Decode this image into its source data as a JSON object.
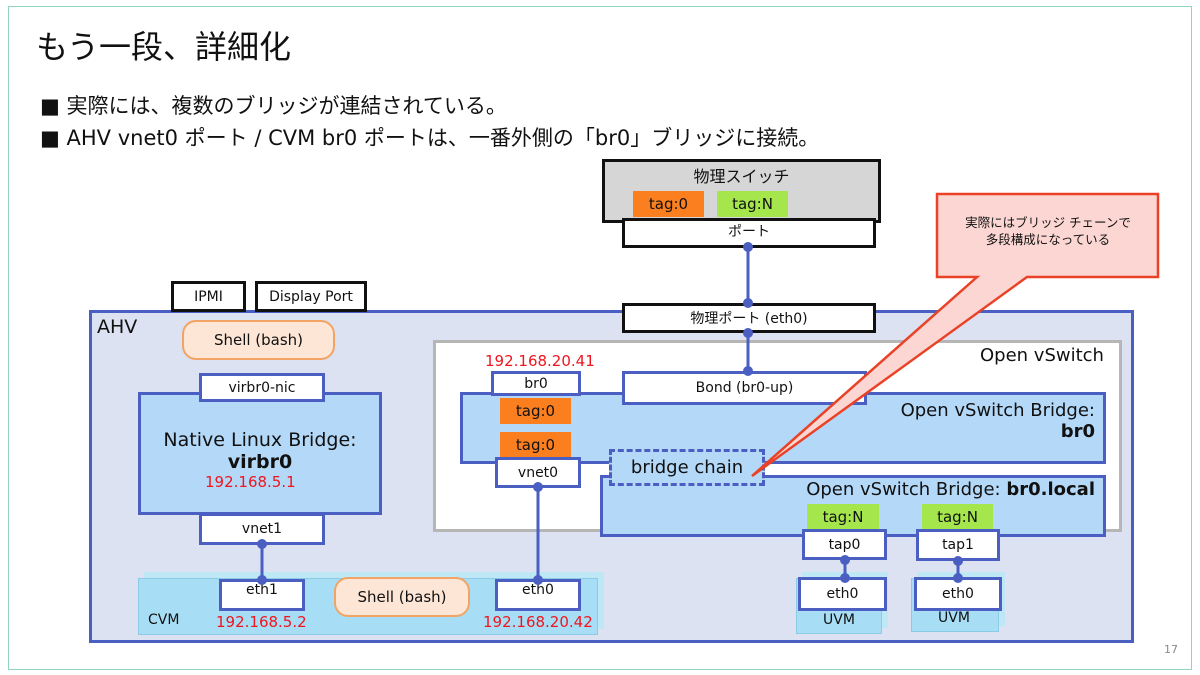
{
  "title": "もう一段、詳細化",
  "bullets": [
    "■ 実際には、複数のブリッジが連結されている。",
    "■ AHV vnet0 ポート / CVM br0 ポートは、一番外側の「br0」ブリッジに接続。"
  ],
  "switch": {
    "label": "物理スイッチ",
    "tag0": "tag:0",
    "tagN": "tag:N",
    "port": "ポート"
  },
  "callout": {
    "line1": "実際にはブリッジ チェーンで",
    "line2": "多段構成になっている"
  },
  "ahv": {
    "label": "AHV",
    "ipmi": "IPMI",
    "display_port": "Display Port",
    "phys_port": "物理ポート (eth0)",
    "shell": "Shell (bash)"
  },
  "linux_bridge": {
    "nic": "virbr0-nic",
    "title": "Native Linux Bridge:",
    "name": "virbr0",
    "ip": "192.168.5.1",
    "vnet": "vnet1"
  },
  "ovs": {
    "label": "Open vSwitch",
    "br0_port": "br0",
    "br0_ip": "192.168.20.41",
    "tag_br0": "tag:0",
    "tag_vnet0": "tag:0",
    "vnet0": "vnet0",
    "bond": "Bond (br0-up)",
    "bridge_title": "Open vSwitch Bridge:",
    "bridge_name": "br0",
    "chain": "bridge chain",
    "local_title": "Open vSwitch Bridge: ",
    "local_name": "br0.local",
    "tap0_tag": "tag:N",
    "tap0": "tap0",
    "tap1_tag": "tag:N",
    "tap1": "tap1"
  },
  "cvm": {
    "label": "CVM",
    "eth1": "eth1",
    "eth1_ip": "192.168.5.2",
    "shell": "Shell (bash)",
    "eth0": "eth0",
    "eth0_ip": "192.168.20.42"
  },
  "uvms": [
    {
      "eth": "eth0",
      "label": "UVM"
    },
    {
      "eth": "eth0",
      "label": "UVM"
    }
  ],
  "page_number": "17"
}
